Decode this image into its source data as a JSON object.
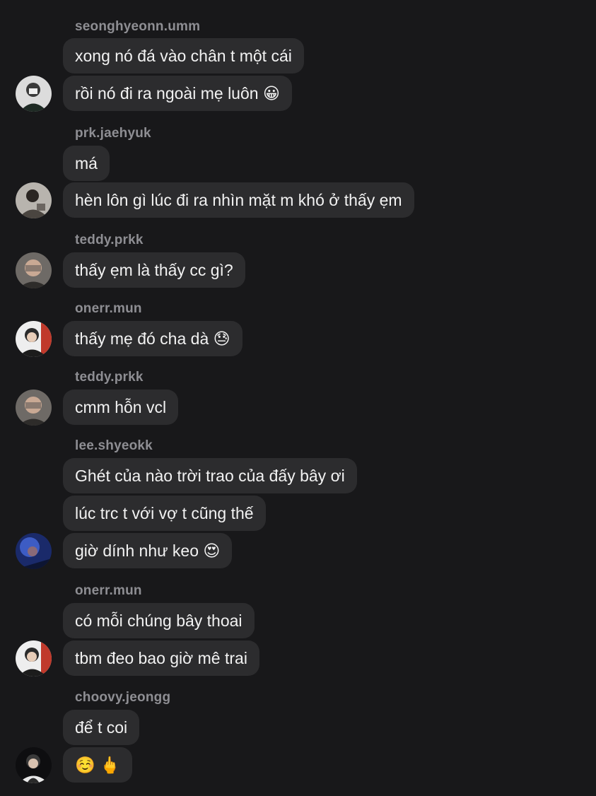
{
  "groups": [
    {
      "sender": "seonghyeonn.umm",
      "messages": [
        "xong nó đá vào chân t một cái",
        "rồi nó đi ra ngoài mẹ luôn 😀"
      ],
      "avatar": "avatar-seonghyeonn"
    },
    {
      "sender": "prk.jaehyuk",
      "messages": [
        "má",
        "hèn lôn gì lúc đi ra nhìn mặt m khó ở thấy ẹm"
      ],
      "avatar": "avatar-jaehyuk"
    },
    {
      "sender": "teddy.prkk",
      "messages": [
        "thấy ẹm là thấy cc gì?"
      ],
      "avatar": "avatar-teddy"
    },
    {
      "sender": "onerr.mun",
      "messages": [
        "thấy mẹ đó cha dà 😓"
      ],
      "avatar": "avatar-onerr"
    },
    {
      "sender": "teddy.prkk",
      "messages": [
        "cmm hỗn vcl"
      ],
      "avatar": "avatar-teddy"
    },
    {
      "sender": "lee.shyeokk",
      "messages": [
        "Ghét của nào trời trao của đấy bây ơi",
        "lúc trc t với vợ t cũng thế",
        "giờ dính như keo 😍"
      ],
      "avatar": "avatar-shyeokk"
    },
    {
      "sender": "onerr.mun",
      "messages": [
        "có mỗi chúng bây thoai",
        "tbm đeo bao giờ mê trai"
      ],
      "avatar": "avatar-onerr"
    },
    {
      "sender": "choovy.jeongg",
      "messages": [
        "để t coi",
        "☺️ 🖕"
      ],
      "avatar": "avatar-choovy"
    }
  ],
  "colors": {
    "background": "#18181a",
    "bubble": "#2c2c2e",
    "sender_text": "#8e8e93",
    "message_text": "#f2f2f2"
  }
}
